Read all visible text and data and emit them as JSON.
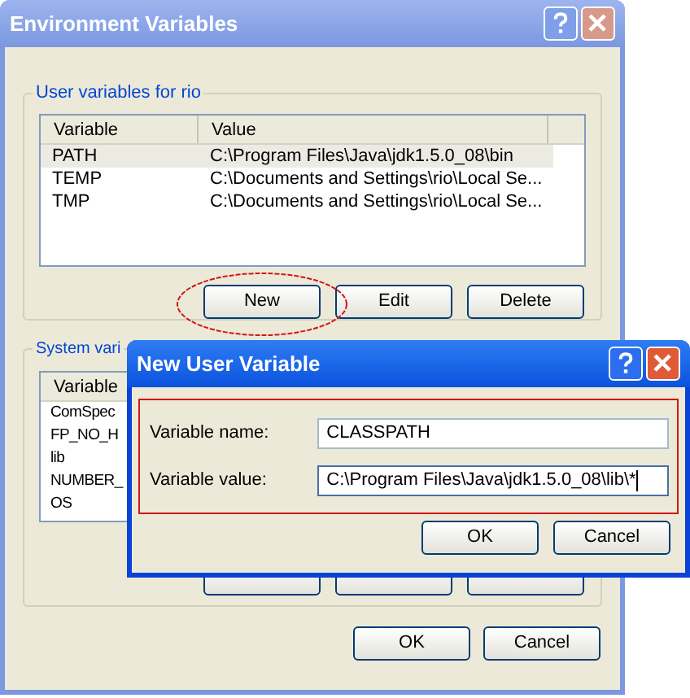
{
  "main_window": {
    "title": "Environment Variables",
    "user_group": {
      "title": "User variables for rio",
      "columns": [
        "Variable",
        "Value"
      ],
      "rows": [
        {
          "variable": "PATH",
          "value": "C:\\Program Files\\Java\\jdk1.5.0_08\\bin",
          "selected": true
        },
        {
          "variable": "TEMP",
          "value": "C:\\Documents and Settings\\rio\\Local Se...",
          "selected": false
        },
        {
          "variable": "TMP",
          "value": "C:\\Documents and Settings\\rio\\Local Se...",
          "selected": false
        }
      ],
      "buttons": [
        "New",
        "Edit",
        "Delete"
      ]
    },
    "system_group": {
      "title": "System vari",
      "columns": [
        "Variable"
      ],
      "rows": [
        "ComSpec",
        "FP_NO_H",
        "lib",
        "NUMBER_",
        "OS"
      ]
    },
    "buttons": [
      "OK",
      "Cancel"
    ]
  },
  "dialog": {
    "title": "New User Variable",
    "fields": [
      {
        "label": "Variable name:",
        "value": "CLASSPATH",
        "focused": false
      },
      {
        "label": "Variable value:",
        "value": "C:\\Program Files\\Java\\jdk1.5.0_08\\lib\\*",
        "focused": true
      }
    ],
    "buttons": [
      "OK",
      "Cancel"
    ]
  }
}
